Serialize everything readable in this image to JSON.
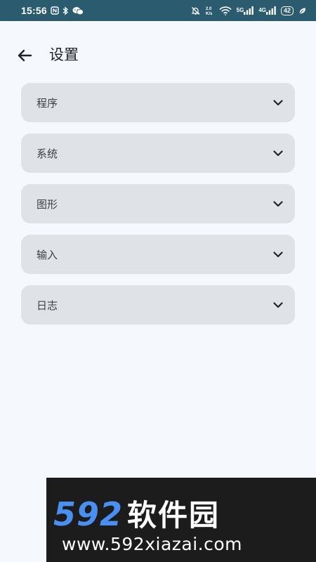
{
  "status_bar": {
    "time": "15:56",
    "network_5g": "5G",
    "network_4g": "4G",
    "battery_level": "42",
    "icons": [
      "nfc-icon",
      "bluetooth-icon",
      "wechat-icon",
      "mute-icon",
      "data-speed-icon",
      "wifi-icon",
      "signal-5g-icon",
      "signal-4g-icon",
      "battery-icon",
      "leaf-icon"
    ],
    "colors": {
      "background": "#2a5b6e",
      "foreground": "#ffffff"
    }
  },
  "header": {
    "back_icon": "arrow-left-icon",
    "title": "设置"
  },
  "sections": [
    {
      "label": "程序",
      "icon": "chevron-down-icon"
    },
    {
      "label": "系统",
      "icon": "chevron-down-icon"
    },
    {
      "label": "图形",
      "icon": "chevron-down-icon"
    },
    {
      "label": "输入",
      "icon": "chevron-down-icon"
    },
    {
      "label": "日志",
      "icon": "chevron-down-icon"
    }
  ],
  "watermark": {
    "number": "592",
    "name": "软件园",
    "url": "www.592xiazai.com"
  },
  "colors": {
    "page_background": "#f5f8fc",
    "card_background": "#dfe3e7",
    "text_primary": "#1f2328",
    "watermark_accent": "#4a8ff2"
  }
}
